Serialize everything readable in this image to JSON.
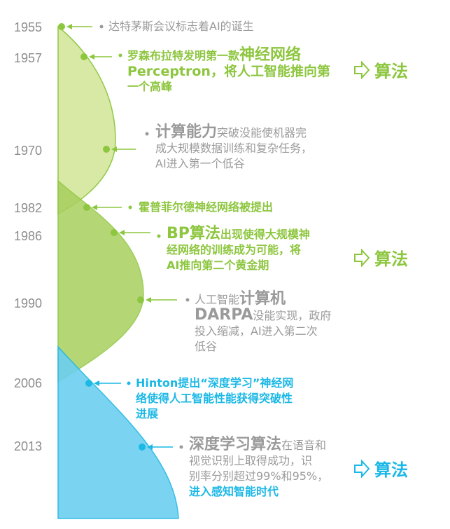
{
  "years": [
    "1955",
    "1957",
    "1970",
    "1982",
    "1986",
    "1990",
    "2006",
    "2013"
  ],
  "events": {
    "e1955": {
      "text": "达特茅斯会议标志着AI的诞生"
    },
    "e1957": {
      "line1": "罗森布拉特发明第一款",
      "line1_em": "神经网络",
      "line2": "Perceptron，将人工智能推向第",
      "line3": "一个高峰"
    },
    "e1970": {
      "em": "计算能力",
      "line1": "突破没能使机器完",
      "line2": "成大规模数据训练和复杂任务，",
      "line3": "AI进入第一个低谷"
    },
    "e1982": {
      "text": "霍普菲尔德神经网络被提出"
    },
    "e1986": {
      "em": "BP算法",
      "line1": "出现使得大规模神",
      "line2": "经网络的训练成为可能，将",
      "line3": "AI推向第二个黄金期"
    },
    "e1990": {
      "line1": "人工智能",
      "line1_em": "计算机",
      "line2_em": "DARPA",
      "line2": "没能实现，政府",
      "line3": "投入缩减，AI进入第二次",
      "line4": "低谷"
    },
    "e2006": {
      "line1": "Hinton提出“深度学习”神经网",
      "line2": "络使得人工智能性能获得突破性",
      "line3": "进展"
    },
    "e2013": {
      "em": "深度学习算法",
      "line1": "在语音和",
      "line2": "视觉识别上取得成功，识",
      "line3": "别率分别超过99%和95%，",
      "line4": "进入感知智能时代"
    }
  },
  "tags": {
    "t1": "算法",
    "t2": "算法",
    "t3": "算法"
  },
  "colors": {
    "green": "#8dc63f",
    "gray": "#9a9a9a",
    "blue": "#1cb8e6",
    "year": "#8c8c8c"
  }
}
